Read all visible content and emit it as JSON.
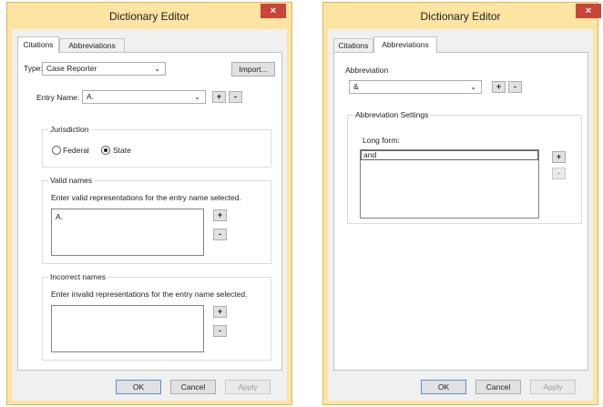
{
  "left_window": {
    "title": "Dictionary Editor",
    "close_glyph": "×",
    "tabs": [
      "Citations",
      "Abbreviations"
    ],
    "type_label": "Type:",
    "type_value": "Case Reporter",
    "import_label": "Import...",
    "entry_name_label": "Entry Name:",
    "entry_name_value": "A.",
    "plus": "+",
    "minus": "-",
    "jurisdiction": {
      "legend": "Jurisdiction",
      "federal_label": "Federal",
      "state_label": "State",
      "selected": "State"
    },
    "valid_names": {
      "legend": "Valid names",
      "hint": "Enter valid representations for the entry name selected.",
      "items": [
        "A."
      ]
    },
    "incorrect_names": {
      "legend": "Incorrect names",
      "hint": "Enter invalid representations for the entry name selected.",
      "items": []
    },
    "footer": {
      "ok": "OK",
      "cancel": "Cancel",
      "apply": "Apply"
    }
  },
  "right_window": {
    "title": "Dictionary Editor",
    "close_glyph": "×",
    "tabs": [
      "Citations",
      "Abbreviations"
    ],
    "abbreviation_label": "Abbreviation",
    "abbreviation_value": "&",
    "plus": "+",
    "minus": "-",
    "settings_legend": "Abbreviation Settings",
    "long_form_label": "Long form:",
    "long_form_items": [
      "and"
    ],
    "footer": {
      "ok": "OK",
      "cancel": "Cancel",
      "apply": "Apply"
    }
  },
  "colors": {
    "title_bar": "#fce4a3",
    "close_button": "#c9453a",
    "panel": "#ffffff",
    "client": "#f0f0f0"
  }
}
